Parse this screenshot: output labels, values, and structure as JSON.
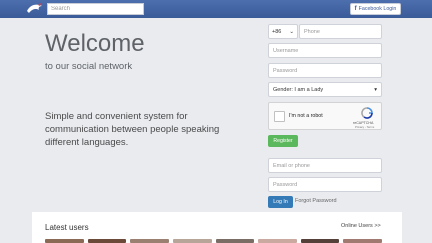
{
  "nav": {
    "search_placeholder": "Search",
    "facebook_icon": "f",
    "facebook_label": "Facebook Login"
  },
  "hero": {
    "title": "Welcome",
    "subtitle": "to our social network",
    "description": "Simple and convenient system for communication between people speaking different languages."
  },
  "signup": {
    "country_code": "+86",
    "phone_placeholder": "Phone",
    "username_placeholder": "Username",
    "password_placeholder": "Password",
    "gender_value": "Gender: I am a Lady",
    "captcha_label": "I'm not a robot",
    "captcha_brand": "reCAPTCHA",
    "captcha_terms": "Privacy - Terms",
    "register_label": "Register"
  },
  "login": {
    "email_placeholder": "Email or phone",
    "password_placeholder": "Password",
    "login_label": "Log In",
    "forgot_label": "Forgot Password"
  },
  "users": {
    "title": "Latest users",
    "online_link": "Online Users >>",
    "thumb_colors": [
      "#8a6a55",
      "#6b4a3a",
      "#9a8070",
      "#b7a59a",
      "#7a6d66",
      "#c9a9a0",
      "#544038",
      "#a07a70"
    ]
  }
}
